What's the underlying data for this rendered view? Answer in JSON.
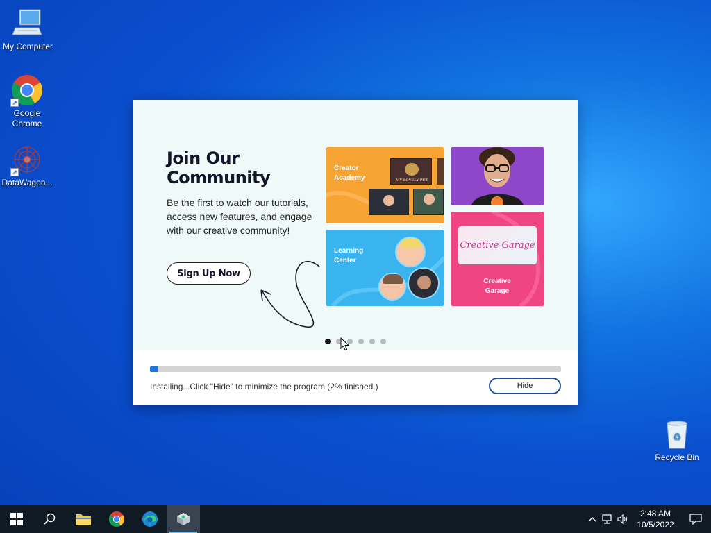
{
  "desktop": {
    "icons": [
      {
        "label": "My Computer"
      },
      {
        "label": "Google Chrome"
      },
      {
        "label": "DataWagon..."
      },
      {
        "label": "Recycle Bin"
      }
    ]
  },
  "installer": {
    "promo": {
      "title": "Join Our Community",
      "description": "Be the first to watch our tutorials, access new features, and engage with our creative community!",
      "signup_label": "Sign Up Now",
      "tiles": {
        "academy": "Creator Academy",
        "academy_thumb": "MY LOVELY PET",
        "learning": "Learning Center",
        "garage_logo": "Creative Garage",
        "garage": "Creative Garage"
      },
      "slide_count": 6,
      "active_slide": 1
    },
    "progress_percent": 2,
    "status_text": "Installing...Click \"Hide\" to minimize the program (2% finished.)",
    "hide_label": "Hide"
  },
  "taskbar": {
    "time": "2:48 AM",
    "date": "10/5/2022"
  },
  "colors": {
    "accent": "#1e74e0",
    "academy_tile": "#f8a435",
    "learning_tile": "#39b4ef",
    "garage_tile": "#f04583",
    "person_tile": "#8d47c8"
  }
}
